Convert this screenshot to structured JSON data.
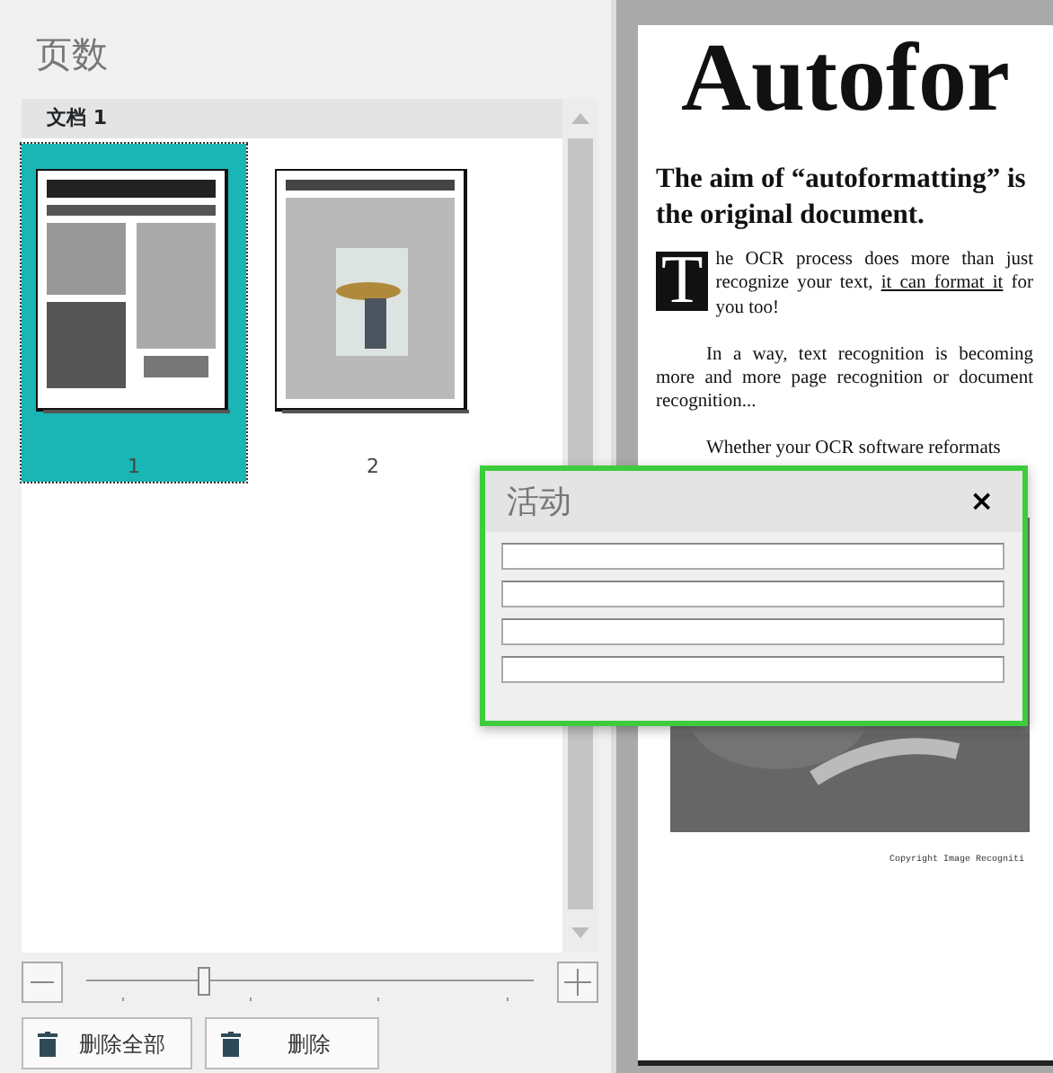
{
  "pages_panel": {
    "title": "页数",
    "document": "文档 1",
    "pages": [
      {
        "number": "1",
        "selected": true
      },
      {
        "number": "2",
        "selected": false
      }
    ],
    "zoom": {
      "level": 0.26
    },
    "buttons": [
      "删除全部",
      "删除"
    ]
  },
  "preview": {
    "title": "Autofor",
    "subtitle": [
      "The aim of “autoformatting” is",
      "the original document."
    ],
    "intro": {
      "dropcap": "T",
      "before": "he OCR process does more than just recognize your text, ",
      "underlined": "it can format it",
      "after": " for you too!"
    },
    "paragraphs": [
      "In a way, text recognition is becoming more and more page recognition or document recognition...",
      "Whether your OCR software reformats"
    ],
    "footer": "Copyright Image Recogniti"
  },
  "dialog": {
    "title": "活动",
    "close": "×",
    "fields": [
      {
        "kind": "line"
      },
      {
        "kind": "line"
      },
      {
        "kind": "line"
      },
      {
        "kind": "line"
      }
    ]
  }
}
